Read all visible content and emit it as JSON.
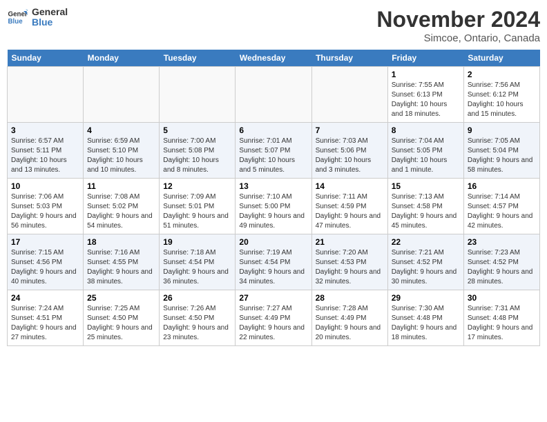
{
  "header": {
    "logo_line1": "General",
    "logo_line2": "Blue",
    "month": "November 2024",
    "location": "Simcoe, Ontario, Canada"
  },
  "weekdays": [
    "Sunday",
    "Monday",
    "Tuesday",
    "Wednesday",
    "Thursday",
    "Friday",
    "Saturday"
  ],
  "weeks": [
    [
      {
        "day": "",
        "info": ""
      },
      {
        "day": "",
        "info": ""
      },
      {
        "day": "",
        "info": ""
      },
      {
        "day": "",
        "info": ""
      },
      {
        "day": "",
        "info": ""
      },
      {
        "day": "1",
        "info": "Sunrise: 7:55 AM\nSunset: 6:13 PM\nDaylight: 10 hours and 18 minutes."
      },
      {
        "day": "2",
        "info": "Sunrise: 7:56 AM\nSunset: 6:12 PM\nDaylight: 10 hours and 15 minutes."
      }
    ],
    [
      {
        "day": "3",
        "info": "Sunrise: 6:57 AM\nSunset: 5:11 PM\nDaylight: 10 hours and 13 minutes."
      },
      {
        "day": "4",
        "info": "Sunrise: 6:59 AM\nSunset: 5:10 PM\nDaylight: 10 hours and 10 minutes."
      },
      {
        "day": "5",
        "info": "Sunrise: 7:00 AM\nSunset: 5:08 PM\nDaylight: 10 hours and 8 minutes."
      },
      {
        "day": "6",
        "info": "Sunrise: 7:01 AM\nSunset: 5:07 PM\nDaylight: 10 hours and 5 minutes."
      },
      {
        "day": "7",
        "info": "Sunrise: 7:03 AM\nSunset: 5:06 PM\nDaylight: 10 hours and 3 minutes."
      },
      {
        "day": "8",
        "info": "Sunrise: 7:04 AM\nSunset: 5:05 PM\nDaylight: 10 hours and 1 minute."
      },
      {
        "day": "9",
        "info": "Sunrise: 7:05 AM\nSunset: 5:04 PM\nDaylight: 9 hours and 58 minutes."
      }
    ],
    [
      {
        "day": "10",
        "info": "Sunrise: 7:06 AM\nSunset: 5:03 PM\nDaylight: 9 hours and 56 minutes."
      },
      {
        "day": "11",
        "info": "Sunrise: 7:08 AM\nSunset: 5:02 PM\nDaylight: 9 hours and 54 minutes."
      },
      {
        "day": "12",
        "info": "Sunrise: 7:09 AM\nSunset: 5:01 PM\nDaylight: 9 hours and 51 minutes."
      },
      {
        "day": "13",
        "info": "Sunrise: 7:10 AM\nSunset: 5:00 PM\nDaylight: 9 hours and 49 minutes."
      },
      {
        "day": "14",
        "info": "Sunrise: 7:11 AM\nSunset: 4:59 PM\nDaylight: 9 hours and 47 minutes."
      },
      {
        "day": "15",
        "info": "Sunrise: 7:13 AM\nSunset: 4:58 PM\nDaylight: 9 hours and 45 minutes."
      },
      {
        "day": "16",
        "info": "Sunrise: 7:14 AM\nSunset: 4:57 PM\nDaylight: 9 hours and 42 minutes."
      }
    ],
    [
      {
        "day": "17",
        "info": "Sunrise: 7:15 AM\nSunset: 4:56 PM\nDaylight: 9 hours and 40 minutes."
      },
      {
        "day": "18",
        "info": "Sunrise: 7:16 AM\nSunset: 4:55 PM\nDaylight: 9 hours and 38 minutes."
      },
      {
        "day": "19",
        "info": "Sunrise: 7:18 AM\nSunset: 4:54 PM\nDaylight: 9 hours and 36 minutes."
      },
      {
        "day": "20",
        "info": "Sunrise: 7:19 AM\nSunset: 4:54 PM\nDaylight: 9 hours and 34 minutes."
      },
      {
        "day": "21",
        "info": "Sunrise: 7:20 AM\nSunset: 4:53 PM\nDaylight: 9 hours and 32 minutes."
      },
      {
        "day": "22",
        "info": "Sunrise: 7:21 AM\nSunset: 4:52 PM\nDaylight: 9 hours and 30 minutes."
      },
      {
        "day": "23",
        "info": "Sunrise: 7:23 AM\nSunset: 4:52 PM\nDaylight: 9 hours and 28 minutes."
      }
    ],
    [
      {
        "day": "24",
        "info": "Sunrise: 7:24 AM\nSunset: 4:51 PM\nDaylight: 9 hours and 27 minutes."
      },
      {
        "day": "25",
        "info": "Sunrise: 7:25 AM\nSunset: 4:50 PM\nDaylight: 9 hours and 25 minutes."
      },
      {
        "day": "26",
        "info": "Sunrise: 7:26 AM\nSunset: 4:50 PM\nDaylight: 9 hours and 23 minutes."
      },
      {
        "day": "27",
        "info": "Sunrise: 7:27 AM\nSunset: 4:49 PM\nDaylight: 9 hours and 22 minutes."
      },
      {
        "day": "28",
        "info": "Sunrise: 7:28 AM\nSunset: 4:49 PM\nDaylight: 9 hours and 20 minutes."
      },
      {
        "day": "29",
        "info": "Sunrise: 7:30 AM\nSunset: 4:48 PM\nDaylight: 9 hours and 18 minutes."
      },
      {
        "day": "30",
        "info": "Sunrise: 7:31 AM\nSunset: 4:48 PM\nDaylight: 9 hours and 17 minutes."
      }
    ]
  ]
}
